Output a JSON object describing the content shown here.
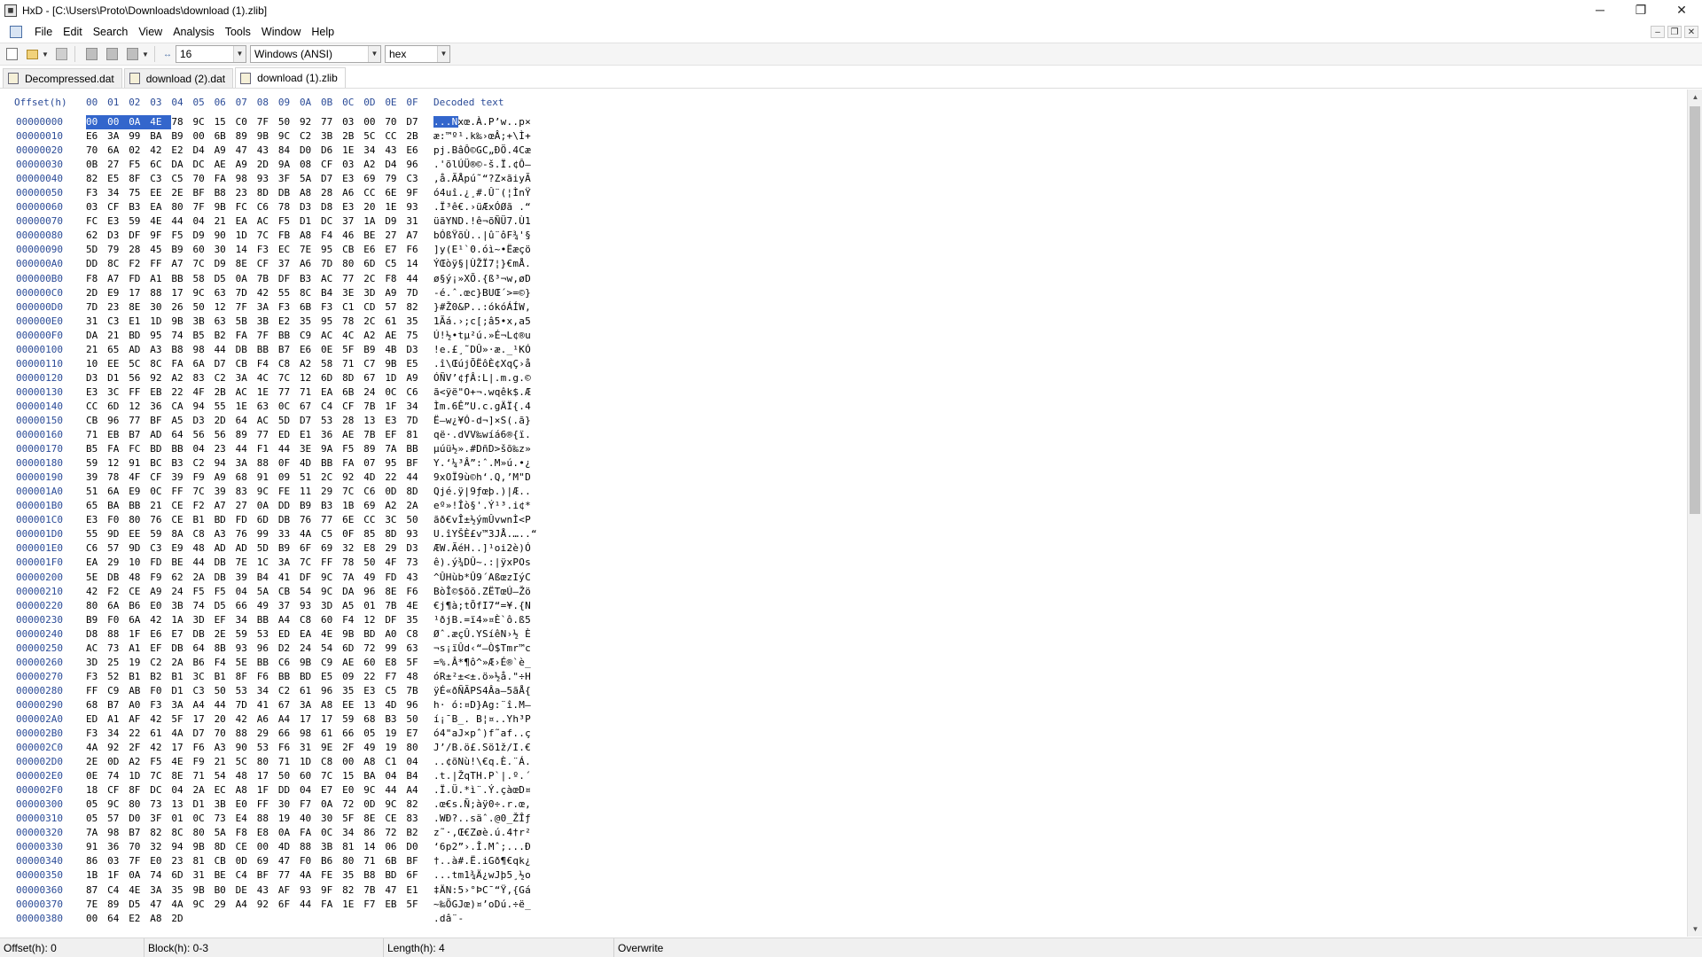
{
  "window": {
    "title": "HxD - [C:\\Users\\Proto\\Downloads\\download (1).zlib]",
    "minimize": "─",
    "maximize": "❐",
    "close": "✕"
  },
  "menu": [
    "File",
    "Edit",
    "Search",
    "View",
    "Analysis",
    "Tools",
    "Window",
    "Help"
  ],
  "mdi": {
    "min": "–",
    "restore": "❐",
    "close": "✕"
  },
  "toolbar": {
    "bytes_per_row": "16",
    "charset": "Windows (ANSI)",
    "offset_base": "hex"
  },
  "tabs": [
    {
      "label": "Decompressed.dat",
      "active": false
    },
    {
      "label": "download (2).dat",
      "active": false
    },
    {
      "label": "download (1).zlib",
      "active": true
    }
  ],
  "editor": {
    "offset_header": "Offset(h)",
    "column_headers": [
      "00",
      "01",
      "02",
      "03",
      "04",
      "05",
      "06",
      "07",
      "08",
      "09",
      "0A",
      "0B",
      "0C",
      "0D",
      "0E",
      "0F"
    ],
    "decoded_header": "Decoded text",
    "rows": [
      {
        "offset": "00000000",
        "hex": "00 00 0A 4E 78 9C 15 C0 7F 50 92 77 03 00 70 D7",
        "text": "...Nxœ.À.P’w..p×"
      },
      {
        "offset": "00000010",
        "hex": "E6 3A 99 BA B9 00 6B 89 9B 9C C2 3B 2B 5C CC 2B",
        "text": "æ:™º¹.k‰›œÂ;+\\Ì+"
      },
      {
        "offset": "00000020",
        "hex": "70 6A 02 42 E2 D4 A9 47 43 84 D0 D6 1E 34 43 E6",
        "text": "pj.BâÔ©GC„ÐÖ.4Cæ"
      },
      {
        "offset": "00000030",
        "hex": "0B 27 F5 6C DA DC AE A9 2D 9A 08 CF 03 A2 D4 96",
        "text": ".'õlÚÜ®©-š.Ï.¢Ô–"
      },
      {
        "offset": "00000040",
        "hex": "82 E5 8F C3 C5 70 FA 98 93 3F 5A D7 E3 69 79 C3",
        "text": "‚å.ÃÅpú˜“?Z×ãiyÃ"
      },
      {
        "offset": "00000050",
        "hex": "F3 34 75 EE 2E BF B8 23 8D DB A8 28 A6 CC 6E 9F",
        "text": "ó4uî.¿¸#.Û¨(¦ÌnŸ"
      },
      {
        "offset": "00000060",
        "hex": "03 CF B3 EA 80 7F 9B FC C6 78 D3 D8 E3 20 1E 93",
        "text": ".Ï³ê€.›üÆxÓØã .“"
      },
      {
        "offset": "00000070",
        "hex": "FC E3 59 4E 44 04 21 EA AC F5 D1 DC 37 1A D9 31",
        "text": "üãYND.!ê¬õÑÜ7.Ù1"
      },
      {
        "offset": "00000080",
        "hex": "62 D3 DF 9F F5 D9 90 1D 7C FB A8 F4 46 BE 27 A7",
        "text": "bÓßŸõÙ..|û¨ôF¾'§"
      },
      {
        "offset": "00000090",
        "hex": "5D 79 28 45 B9 60 30 14 F3 EC 7E 95 CB E6 E7 F6",
        "text": "]y(E¹`0.óì~•Ëæçö"
      },
      {
        "offset": "000000A0",
        "hex": "DD 8C F2 FF A7 7C D9 8E CF 37 A6 7D 80 6D C5 14",
        "text": "ÝŒòÿ§|ÙŽÏ7¦}€mÅ."
      },
      {
        "offset": "000000B0",
        "hex": "F8 A7 FD A1 BB 58 D5 0A 7B DF B3 AC 77 2C F8 44",
        "text": "ø§ý¡»XÕ.{ß³¬w,øD"
      },
      {
        "offset": "000000C0",
        "hex": "2D E9 17 88 17 9C 63 7D 42 55 8C B4 3E 3D A9 7D",
        "text": "-é.ˆ.œc}BUŒ´>=©}"
      },
      {
        "offset": "000000D0",
        "hex": "7D 23 8E 30 26 50 12 7F 3A F3 6B F3 C1 CD 57 82",
        "text": "}#Ž0&P..:ókóÁÍW‚"
      },
      {
        "offset": "000000E0",
        "hex": "31 C3 E1 1D 9B 3B 63 5B 3B E2 35 95 78 2C 61 35",
        "text": "1Ãá.›;c[;â5•x,a5"
      },
      {
        "offset": "000000F0",
        "hex": "DA 21 BD 95 74 B5 B2 FA 7F BB C9 AC 4C A2 AE 75",
        "text": "Ú!½•tµ²ú.»É¬L¢®u"
      },
      {
        "offset": "00000100",
        "hex": "21 65 AD A3 B8 98 44 DB BB B7 E6 0E 5F B9 4B D3",
        "text": "!e.£¸˜DÛ»·æ._¹KÓ"
      },
      {
        "offset": "00000110",
        "hex": "10 EE 5C 8C FA 6A D7 CB F4 C8 A2 58 71 C7 9B E5",
        "text": ".î\\ŒújÕËôÈ¢XqÇ›å"
      },
      {
        "offset": "00000120",
        "hex": "D3 D1 56 92 A2 83 C2 3A 4C 7C 12 6D 8D 67 1D A9",
        "text": "ÓÑV’¢ƒÂ:L|.m.g.©"
      },
      {
        "offset": "00000130",
        "hex": "E3 3C FF EB 22 4F 2B AC 1E 77 71 EA 6B 24 0C C6",
        "text": "ã<ÿë\"O+¬.wqêk$.Æ"
      },
      {
        "offset": "00000140",
        "hex": "CC 6D 12 36 CA 94 55 1E 63 0C 67 C4 CF 7B 1F 34",
        "text": "Ìm.6Ê”U.c.gÄÏ{.4"
      },
      {
        "offset": "00000150",
        "hex": "CB 96 77 BF A5 D3 2D 64 AC 5D D7 53 28 13 E3 7D",
        "text": "Ë–w¿¥Ó-d¬]×S(.ã}"
      },
      {
        "offset": "00000160",
        "hex": "71 EB B7 AD 64 56 56 89 77 ED E1 36 AE 7B EF 81",
        "text": "që·.dVV‰wíá6®{ï."
      },
      {
        "offset": "00000170",
        "hex": "B5 FA FC BD BB 04 23 44 F1 44 3E 9A F5 89 7A BB",
        "text": "µúü½».#DñD>šõ‰z»"
      },
      {
        "offset": "00000180",
        "hex": "59 12 91 BC B3 C2 94 3A 88 0F 4D BB FA 07 95 BF",
        "text": "Y.‘¼³Â”:ˆ.M»ú.•¿"
      },
      {
        "offset": "00000190",
        "hex": "39 78 4F CF 39 F9 A9 68 91 09 51 2C 92 4D 22 44",
        "text": "9xOÏ9ù©h‘.Q,’M\"D"
      },
      {
        "offset": "000001A0",
        "hex": "51 6A E9 0C FF 7C 39 83 9C FE 11 29 7C C6 0D 8D",
        "text": "Qjé.ÿ|9ƒœþ.)|Æ.."
      },
      {
        "offset": "000001B0",
        "hex": "65 BA BB 21 CE F2 A7 27 0A DD B9 B3 1B 69 A2 2A",
        "text": "eº»!Îò§'.Ý¹³.i¢*"
      },
      {
        "offset": "000001C0",
        "hex": "E3 F0 80 76 CE B1 BD FD 6D DB 76 77 6E CC 3C 50",
        "text": "ãð€vÎ±½ýmÛvwnÌ<P"
      },
      {
        "offset": "000001D0",
        "hex": "55 9D EE 59 8A C8 A3 76 99 33 4A C5 0F 85 8D 93",
        "text": "U.îYŠÈ£v™3JÅ.…..“"
      },
      {
        "offset": "000001E0",
        "hex": "C6 57 9D C3 E9 48 AD AD 5D B9 6F 69 32 E8 29 D3",
        "text": "ÆW.ÃéH..]¹oi2è)Ó"
      },
      {
        "offset": "000001F0",
        "hex": "EA 29 10 FD BE 44 DB 7E 1C 3A 7C FF 78 50 4F 73",
        "text": "ê).ý¾DÛ~.:|ÿxPOs"
      },
      {
        "offset": "00000200",
        "hex": "5E DB 48 F9 62 2A DB 39 B4 41 DF 9C 7A 49 FD 43",
        "text": "^ÛHùb*Û9´AßœzIýC"
      },
      {
        "offset": "00000210",
        "hex": "42 F2 CE A9 24 F5 F5 04 5A CB 54 9C DA 96 8E F6",
        "text": "BòÎ©$õõ.ZËTœÚ–Žö"
      },
      {
        "offset": "00000220",
        "hex": "80 6A B6 E0 3B 74 D5 66 49 37 93 3D A5 01 7B 4E",
        "text": "€j¶à;tÕfI7“=¥.{N"
      },
      {
        "offset": "00000230",
        "hex": "B9 F0 6A 42 1A 3D EF 34 BB A4 C8 60 F4 12 DF 35",
        "text": "¹ðjB.=ï4»¤È`ô.ß5"
      },
      {
        "offset": "00000240",
        "hex": "D8 88 1F E6 E7 DB 2E 59 53 ED EA 4E 9B BD A0 C8",
        "text": "Øˆ.æçÛ.YSíêN›½ È"
      },
      {
        "offset": "00000250",
        "hex": "AC 73 A1 EF DB 64 8B 93 96 D2 24 54 6D 72 99 63",
        "text": "¬s¡ïÛd‹“–Ò$Tmr™c"
      },
      {
        "offset": "00000260",
        "hex": "3D 25 19 C2 2A B6 F4 5E BB C6 9B C9 AE 60 E8 5F",
        "text": "=%.Â*¶ô^»Æ›É®`è_"
      },
      {
        "offset": "00000270",
        "hex": "F3 52 B1 B2 B1 3C B1 8F F6 BB BD E5 09 22 F7 48",
        "text": "óR±²±<±.ö»½å.\"÷H"
      },
      {
        "offset": "00000280",
        "hex": "FF C9 AB F0 D1 C3 50 53 34 C2 61 96 35 E3 C5 7B",
        "text": "ÿÉ«ðÑÃPS4Âa–5ãÅ{"
      },
      {
        "offset": "00000290",
        "hex": "68 B7 A0 F3 3A A4 44 7D 41 67 3A A8 EE 13 4D 96",
        "text": "h· ó:¤D}Ag:¨î.M–"
      },
      {
        "offset": "000002A0",
        "hex": "ED A1 AF 42 5F 17 20 42 A6 A4 17 17 59 68 B3 50",
        "text": "í¡¯B_. B¦¤..Yh³P"
      },
      {
        "offset": "000002B0",
        "hex": "F3 34 22 61 4A D7 70 88 29 66 98 61 66 05 19 E7",
        "text": "ó4\"aJ×pˆ)f˜af..ç"
      },
      {
        "offset": "000002C0",
        "hex": "4A 92 2F 42 17 F6 A3 90 53 F6 31 9E 2F 49 19 80",
        "text": "J’/B.ö£.Sö1ž/I.€"
      },
      {
        "offset": "000002D0",
        "hex": "2E 0D A2 F5 4E F9 21 5C 80 71 1D C8 00 A8 C1 04",
        "text": "..¢õNù!\\€q.È.¨Á."
      },
      {
        "offset": "000002E0",
        "hex": "0E 74 1D 7C 8E 71 54 48 17 50 60 7C 15 BA 04 B4",
        "text": ".t.|ŽqTH.P`|.º.´"
      },
      {
        "offset": "000002F0",
        "hex": "18 CF 8F DC 04 2A EC A8 1F DD 04 E7 E0 9C 44 A4",
        "text": ".Ï.Ü.*ì¨.Ý.çàœD¤"
      },
      {
        "offset": "00000300",
        "hex": "05 9C 80 73 13 D1 3B E0 FF 30 F7 0A 72 0D 9C 82",
        "text": ".œ€s.Ñ;àÿ0÷.r.œ‚"
      },
      {
        "offset": "00000310",
        "hex": "05 57 D0 3F 01 0C 73 E4 88 19 40 30 5F 8E CE 83",
        "text": ".WÐ?..säˆ.@0_ŽÎƒ"
      },
      {
        "offset": "00000320",
        "hex": "7A 98 B7 82 8C 80 5A F8 E8 0A FA 0C 34 86 72 B2",
        "text": "z˜·‚Œ€Zøè.ú.4†r²"
      },
      {
        "offset": "00000330",
        "hex": "91 36 70 32 94 9B 8D CE 00 4D 88 3B 81 14 06 D0",
        "text": "‘6p2”›.Î.Mˆ;...Ð"
      },
      {
        "offset": "00000340",
        "hex": "86 03 7F E0 23 81 CB 0D 69 47 F0 B6 80 71 6B BF",
        "text": "†..à#.Ë.iGð¶€qk¿"
      },
      {
        "offset": "00000350",
        "hex": "1B 1F 0A 74 6D 31 BE C4 BF 77 4A FE 35 B8 BD 6F",
        "text": "...tm1¾Ä¿wJþ5¸½o"
      },
      {
        "offset": "00000360",
        "hex": "87 C4 4E 3A 35 9B B0 DE 43 AF 93 9F 82 7B 47 E1",
        "text": "‡ÄN:5›°ÞC¯“Ÿ‚{Gá"
      },
      {
        "offset": "00000370",
        "hex": "7E 89 D5 47 4A 9C 29 A4 92 6F 44 FA 1E F7 EB 5F",
        "text": "~‰ÕGJœ)¤’oDú.÷ë_"
      },
      {
        "offset": "00000380",
        "hex": "00 64 E2 A8 2D",
        "text": ".dâ¨-"
      }
    ]
  },
  "status": {
    "offset": "Offset(h): 0",
    "block": "Block(h): 0-3",
    "length": "Length(h): 4",
    "mode": "Overwrite"
  },
  "colors": {
    "offset_color": "#2b4b97",
    "selection": "#3366cc"
  }
}
